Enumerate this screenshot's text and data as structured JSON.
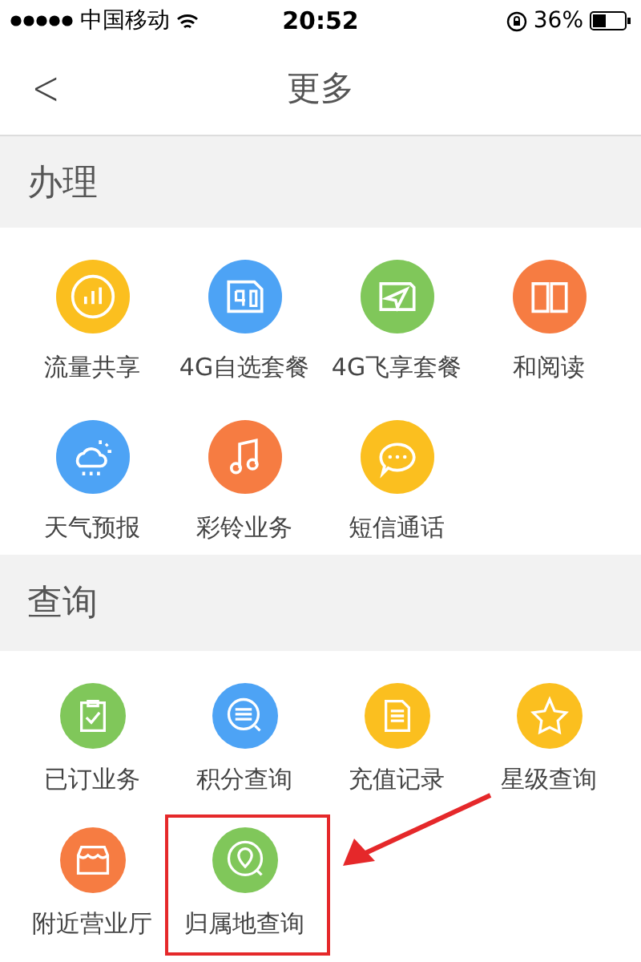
{
  "status_bar": {
    "carrier": "中国移动",
    "time": "20:52",
    "battery": "36%"
  },
  "nav_bar": {
    "back": "<",
    "title": "更多"
  },
  "sections": [
    {
      "title": "办理",
      "items": [
        {
          "label": "流量共享",
          "color": "#fbbf1f",
          "highlighted": false
        },
        {
          "label": "4G自选套餐",
          "color": "#4da3f5",
          "highlighted": false
        },
        {
          "label": "4G飞享套餐",
          "color": "#80c75a",
          "highlighted": false
        },
        {
          "label": "和阅读",
          "color": "#f67c42",
          "highlighted": false
        },
        {
          "label": "天气预报",
          "color": "#4da3f5",
          "highlighted": false
        },
        {
          "label": "彩铃业务",
          "color": "#f67c42",
          "highlighted": false
        },
        {
          "label": "短信通话",
          "color": "#fbbf1f",
          "highlighted": false
        }
      ]
    },
    {
      "title": "查询",
      "items": [
        {
          "label": "已订业务",
          "color": "#80c75a",
          "highlighted": false
        },
        {
          "label": "积分查询",
          "color": "#4da3f5",
          "highlighted": false
        },
        {
          "label": "充值记录",
          "color": "#fbbf1f",
          "highlighted": false
        },
        {
          "label": "星级查询",
          "color": "#fbbf1f",
          "highlighted": false
        },
        {
          "label": "附近营业厅",
          "color": "#f67c42",
          "highlighted": false
        },
        {
          "label": "归属地查询",
          "color": "#80c75a",
          "highlighted": true
        }
      ]
    }
  ]
}
